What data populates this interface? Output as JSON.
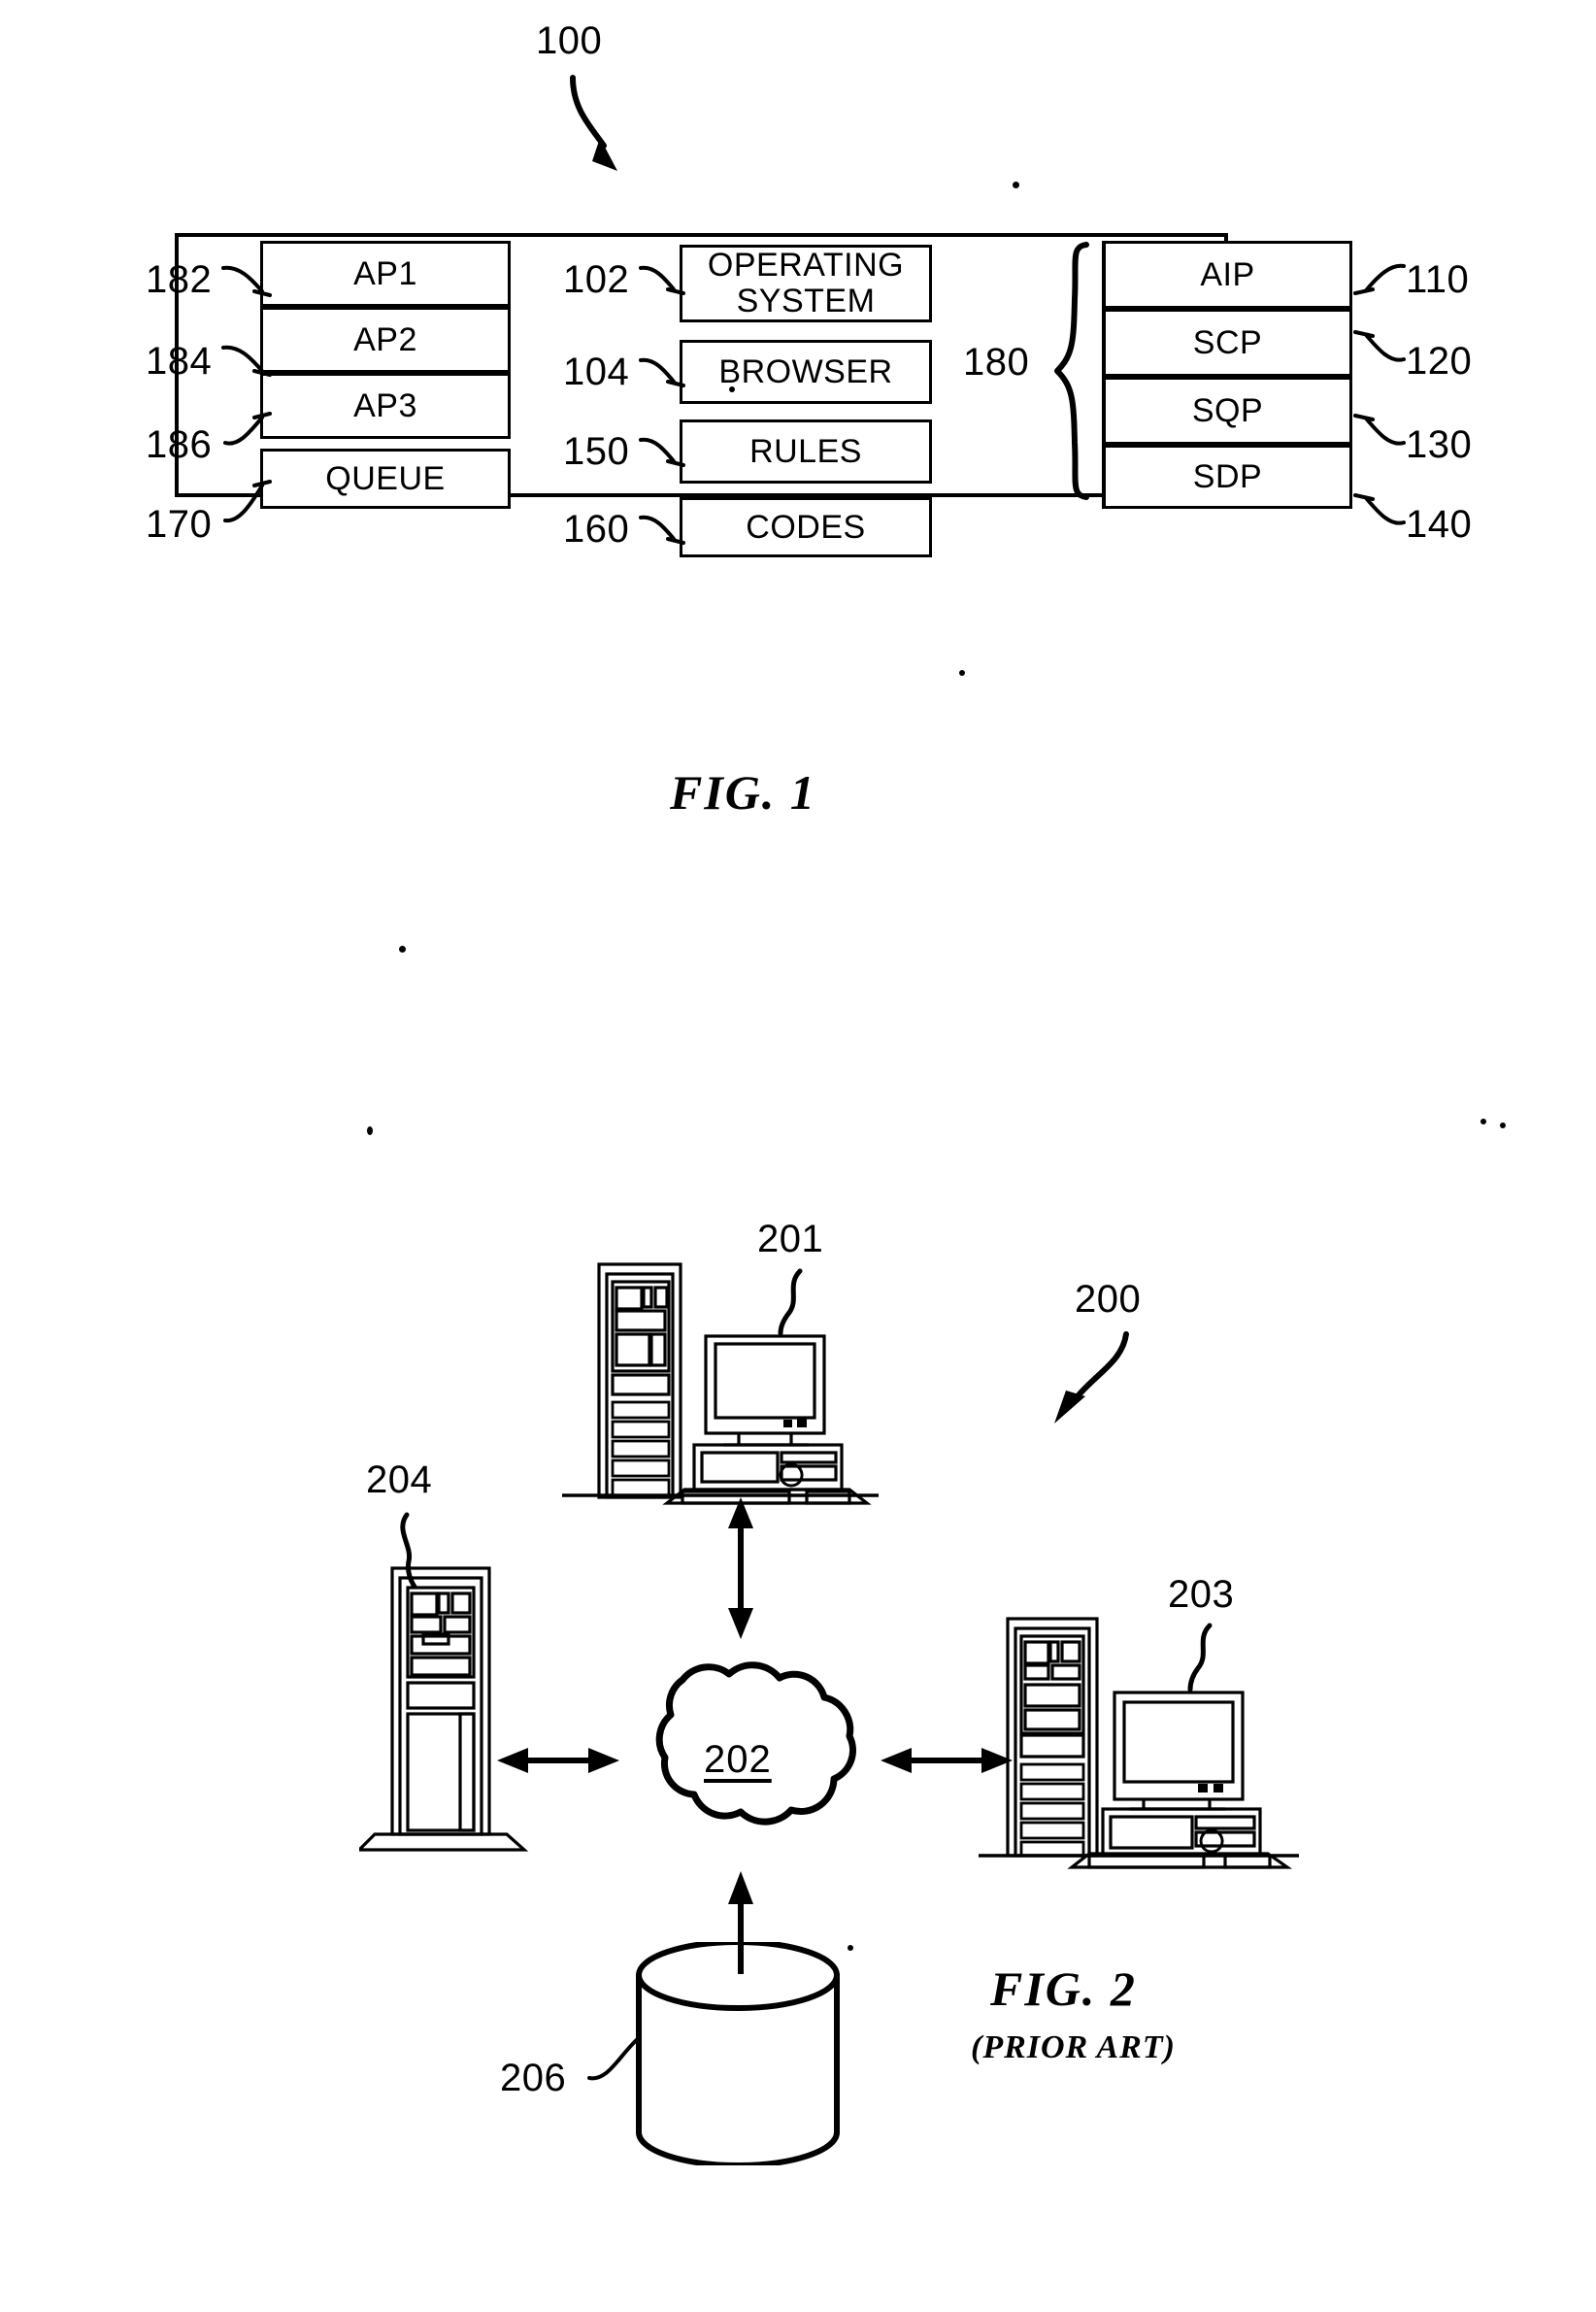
{
  "figure1": {
    "ref_number": "100",
    "caption": "FIG. 1",
    "left_column": {
      "cells": [
        {
          "label": "AP1",
          "ref": "182"
        },
        {
          "label": "AP2",
          "ref": "184"
        },
        {
          "label": "AP3",
          "ref": "186"
        }
      ],
      "queue": {
        "label": "QUEUE",
        "ref": "170"
      }
    },
    "middle_column": {
      "cells": [
        {
          "label": "OPERATING SYSTEM",
          "line1": "OPERATING",
          "line2": "SYSTEM",
          "ref": "102"
        },
        {
          "label": "BROWSER",
          "ref": "104"
        },
        {
          "label": "RULES",
          "ref": "150"
        },
        {
          "label": "CODES",
          "ref": "160"
        }
      ]
    },
    "brace": {
      "ref": "180"
    },
    "right_column": {
      "cells": [
        {
          "label": "AIP",
          "ref": "110"
        },
        {
          "label": "SCP",
          "ref": "120"
        },
        {
          "label": "SQP",
          "ref": "130"
        },
        {
          "label": "SDP",
          "ref": "140"
        }
      ]
    }
  },
  "figure2": {
    "ref_number": "200",
    "caption": "FIG. 2",
    "subcaption": "(PRIOR ART)",
    "nodes": [
      {
        "name": "workstation-top",
        "ref": "201",
        "icon": "computer-workstation-icon"
      },
      {
        "name": "network-cloud",
        "ref": "202",
        "icon": "cloud-icon"
      },
      {
        "name": "workstation-right",
        "ref": "203",
        "icon": "computer-workstation-icon"
      },
      {
        "name": "server-tower-left",
        "ref": "204",
        "icon": "server-tower-icon"
      },
      {
        "name": "database",
        "ref": "206",
        "icon": "database-cylinder-icon"
      }
    ]
  }
}
